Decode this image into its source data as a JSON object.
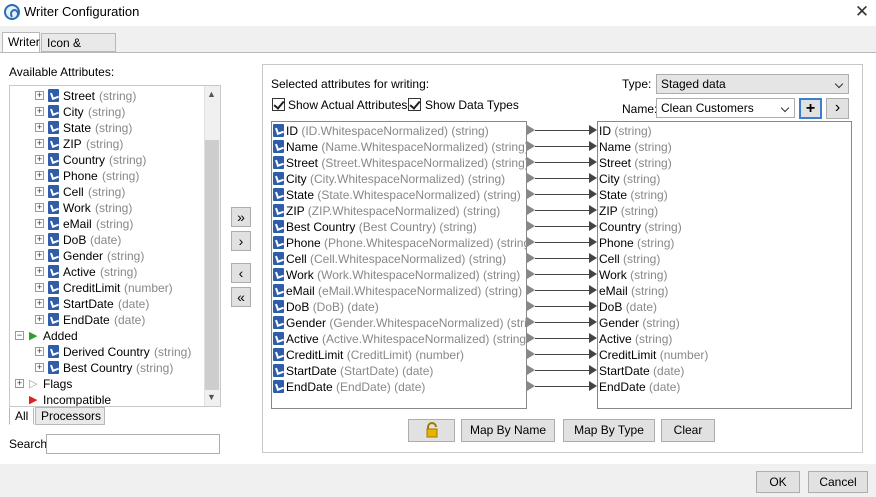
{
  "window": {
    "title": "Writer Configuration",
    "close": "✕"
  },
  "tabs": [
    {
      "label": "Writer"
    },
    {
      "label": "Icon & Family"
    }
  ],
  "left": {
    "header": "Available Attributes:",
    "tree_items": [
      {
        "label": "Street",
        "type": "(string)"
      },
      {
        "label": "City",
        "type": "(string)"
      },
      {
        "label": "State",
        "type": "(string)"
      },
      {
        "label": "ZIP",
        "type": "(string)"
      },
      {
        "label": "Country",
        "type": "(string)"
      },
      {
        "label": "Phone",
        "type": "(string)"
      },
      {
        "label": "Cell",
        "type": "(string)"
      },
      {
        "label": "Work",
        "type": "(string)"
      },
      {
        "label": "eMail",
        "type": "(string)"
      },
      {
        "label": "DoB",
        "type": "(date)"
      },
      {
        "label": "Gender",
        "type": "(string)"
      },
      {
        "label": "Active",
        "type": "(string)"
      },
      {
        "label": "CreditLimit",
        "type": "(number)"
      },
      {
        "label": "StartDate",
        "type": "(date)"
      },
      {
        "label": "EndDate",
        "type": "(date)"
      }
    ],
    "added_group": "Added",
    "added_items": [
      {
        "label": "Derived Country",
        "type": "(string)"
      },
      {
        "label": "Best Country",
        "type": "(string)"
      }
    ],
    "flags_group": "Flags",
    "incompatible_group": "Incompatible",
    "bottom_tabs": [
      "All",
      "Processors"
    ],
    "search_label": "Search",
    "search_value": ""
  },
  "middle_buttons": [
    "»",
    "›",
    "‹",
    "«"
  ],
  "right": {
    "header": "Selected attributes for writing:",
    "show_actual": "Show Actual Attributes",
    "show_types": "Show Data Types",
    "type_label": "Type:",
    "type_value": "Staged data",
    "name_label": "Name:",
    "name_value": "Clean Customers",
    "add_btn": "+",
    "next_btn": "›",
    "source_items": [
      {
        "label": "ID",
        "detail": "(ID.WhitespaceNormalized) (string)"
      },
      {
        "label": "Name",
        "detail": "(Name.WhitespaceNormalized) (string)"
      },
      {
        "label": "Street",
        "detail": "(Street.WhitespaceNormalized) (string)"
      },
      {
        "label": "City",
        "detail": "(City.WhitespaceNormalized) (string)"
      },
      {
        "label": "State",
        "detail": "(State.WhitespaceNormalized) (string)"
      },
      {
        "label": "ZIP",
        "detail": "(ZIP.WhitespaceNormalized) (string)"
      },
      {
        "label": "Best Country",
        "detail": "(Best Country) (string)"
      },
      {
        "label": "Phone",
        "detail": "(Phone.WhitespaceNormalized) (string)"
      },
      {
        "label": "Cell",
        "detail": "(Cell.WhitespaceNormalized) (string)"
      },
      {
        "label": "Work",
        "detail": "(Work.WhitespaceNormalized) (string)"
      },
      {
        "label": "eMail",
        "detail": "(eMail.WhitespaceNormalized) (string)"
      },
      {
        "label": "DoB",
        "detail": "(DoB) (date)"
      },
      {
        "label": "Gender",
        "detail": "(Gender.WhitespaceNormalized) (string)"
      },
      {
        "label": "Active",
        "detail": "(Active.WhitespaceNormalized) (string)"
      },
      {
        "label": "CreditLimit",
        "detail": "(CreditLimit) (number)"
      },
      {
        "label": "StartDate",
        "detail": "(StartDate) (date)"
      },
      {
        "label": "EndDate",
        "detail": "(EndDate) (date)"
      }
    ],
    "target_items": [
      {
        "label": "ID",
        "type": "(string)"
      },
      {
        "label": "Name",
        "type": "(string)"
      },
      {
        "label": "Street",
        "type": "(string)"
      },
      {
        "label": "City",
        "type": "(string)"
      },
      {
        "label": "State",
        "type": "(string)"
      },
      {
        "label": "ZIP",
        "type": "(string)"
      },
      {
        "label": "Country",
        "type": "(string)"
      },
      {
        "label": "Phone",
        "type": "(string)"
      },
      {
        "label": "Cell",
        "type": "(string)"
      },
      {
        "label": "Work",
        "type": "(string)"
      },
      {
        "label": "eMail",
        "type": "(string)"
      },
      {
        "label": "DoB",
        "type": "(date)"
      },
      {
        "label": "Gender",
        "type": "(string)"
      },
      {
        "label": "Active",
        "type": "(string)"
      },
      {
        "label": "CreditLimit",
        "type": "(number)"
      },
      {
        "label": "StartDate",
        "type": "(date)"
      },
      {
        "label": "EndDate",
        "type": "(date)"
      }
    ],
    "buttons": {
      "map_by_name": "Map By Name",
      "map_by_type": "Map By Type",
      "clear": "Clear"
    }
  },
  "footer": {
    "ok": "OK",
    "cancel": "Cancel"
  }
}
